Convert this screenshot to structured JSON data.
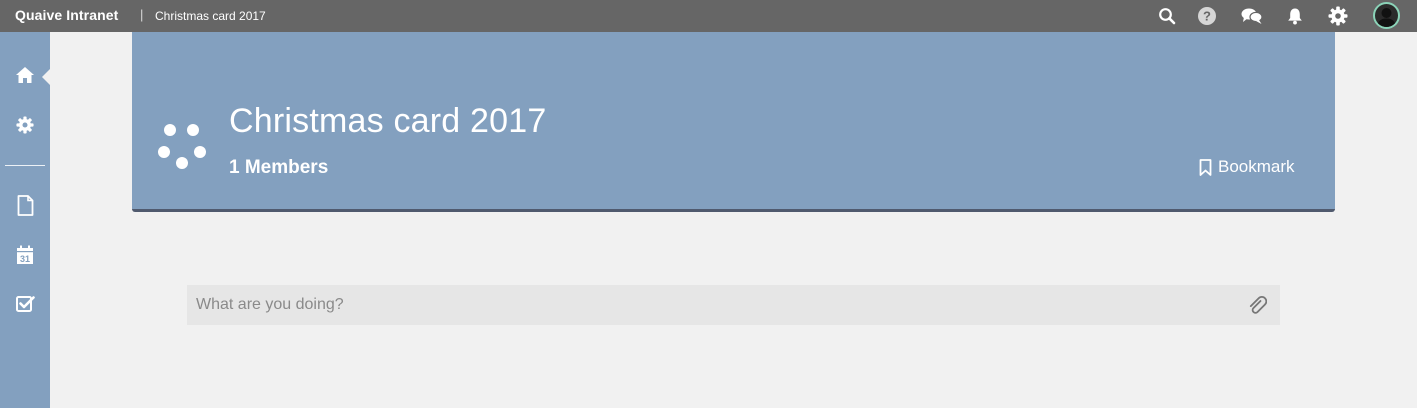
{
  "topbar": {
    "app_title": "Quaive Intranet",
    "separator": "|",
    "breadcrumb": "Christmas card 2017",
    "icons": [
      "search-icon",
      "help-icon",
      "chat-icon",
      "notifications-icon",
      "settings-icon",
      "avatar"
    ]
  },
  "sidebar": {
    "items": [
      {
        "icon": "home-icon",
        "active": true
      },
      {
        "icon": "gear-icon"
      },
      {
        "icon": "document-icon"
      },
      {
        "icon": "calendar-icon",
        "label": "31"
      },
      {
        "icon": "checkbox-icon"
      }
    ]
  },
  "hero": {
    "title": "Christmas card 2017",
    "members": "1 Members",
    "bookmark_label": "Bookmark"
  },
  "status": {
    "placeholder": "What are you doing?"
  },
  "colors": {
    "topbar": "#666666",
    "accent": "#83a0bf",
    "hero_border": "#505a6e",
    "page_bg": "#f1f1f1",
    "input_bg": "#e6e6e6"
  }
}
